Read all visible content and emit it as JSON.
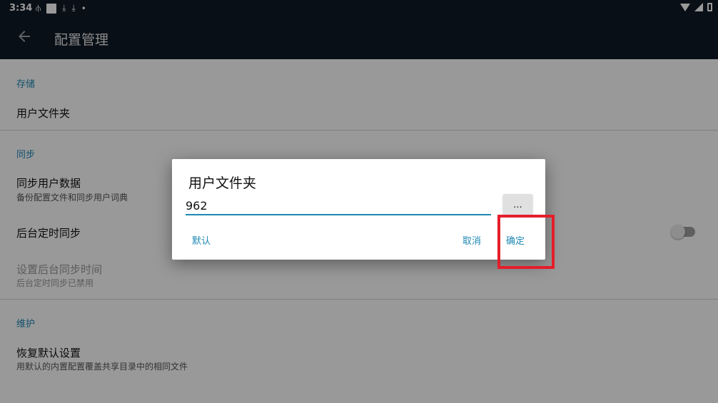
{
  "status_bar": {
    "time": "3:34",
    "left_icons": [
      "usb-icon",
      "square-icon",
      "download-icon",
      "download-icon",
      "dot-icon"
    ],
    "right_icons": [
      "wifi-icon",
      "signal-icon",
      "battery-icon"
    ]
  },
  "app_bar": {
    "title": "配置管理",
    "back_icon": "arrow-left-icon"
  },
  "sections": {
    "storage": {
      "header": "存储",
      "user_folder_title": "用户文件夹"
    },
    "sync": {
      "header": "同步",
      "sync_user_data_title": "同步用户数据",
      "sync_user_data_summary": "备份配置文件和同步用户词典",
      "background_sync_title": "后台定时同步",
      "background_sync_enabled": false,
      "set_sync_time_title": "设置后台同步时间",
      "set_sync_time_summary": "后台定时同步已禁用"
    },
    "maintenance": {
      "header": "维护",
      "reset_title": "恢复默认设置",
      "reset_summary": "用默认的内置配置覆盖共享目录中的相同文件"
    }
  },
  "dialog": {
    "title": "用户文件夹",
    "input_value": "962",
    "browse_label": "...",
    "default_label": "默认",
    "cancel_label": "取消",
    "ok_label": "确定"
  },
  "colors": {
    "accent": "#1e88b4",
    "app_bar": "#0f1a26",
    "highlight": "#e41e2a"
  }
}
